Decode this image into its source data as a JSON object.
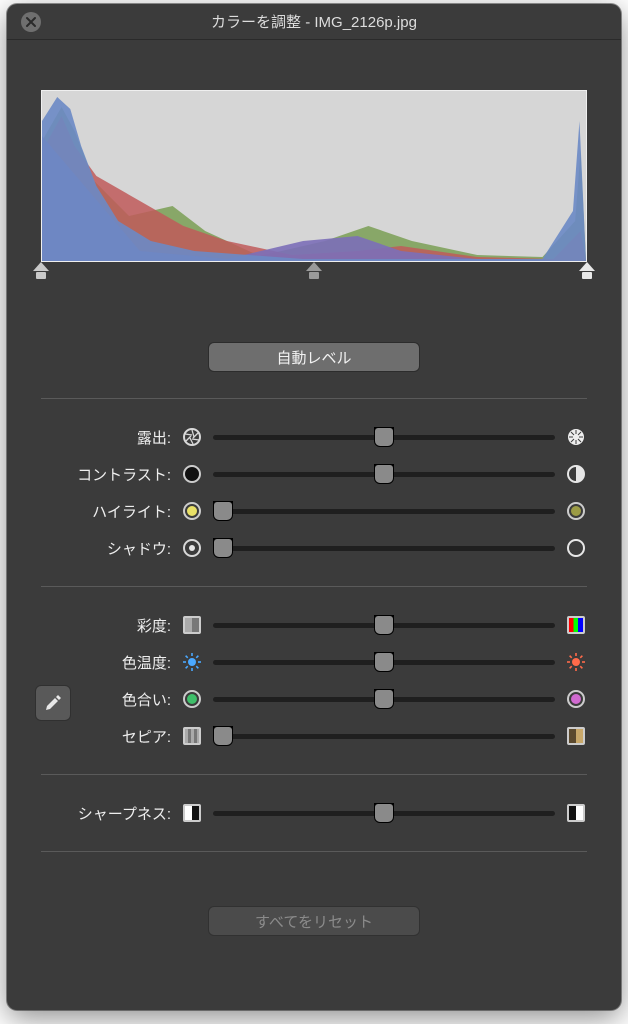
{
  "window": {
    "title": "カラーを調整 - IMG_2126p.jpg"
  },
  "buttons": {
    "auto_levels": "自動レベル",
    "reset_all": "すべてをリセット"
  },
  "histogram": {
    "handles": [
      0,
      50,
      100
    ]
  },
  "groups": [
    {
      "rows": [
        {
          "key": "exposure",
          "label": "露出:",
          "value": 50,
          "left_icon": "aperture",
          "right_icon": "aperture-open"
        },
        {
          "key": "contrast",
          "label": "コントラスト:",
          "value": 50,
          "left_icon": "circle-dark",
          "right_icon": "circle-half"
        },
        {
          "key": "highlights",
          "label": "ハイライト:",
          "value": 3,
          "left_icon": "dot-yellow",
          "right_icon": "dot-olive"
        },
        {
          "key": "shadows",
          "label": "シャドウ:",
          "value": 3,
          "left_icon": "target",
          "right_icon": "ring"
        }
      ]
    },
    {
      "eyedropper": true,
      "rows": [
        {
          "key": "saturation",
          "label": "彩度:",
          "value": 50,
          "left_icon": "sq-gray",
          "right_icon": "sq-rgb"
        },
        {
          "key": "temperature",
          "label": "色温度:",
          "value": 50,
          "left_icon": "sun-blue",
          "right_icon": "sun-red"
        },
        {
          "key": "tint",
          "label": "色合い:",
          "value": 50,
          "left_icon": "dot-green",
          "right_icon": "dot-magenta"
        },
        {
          "key": "sepia",
          "label": "セピア:",
          "value": 3,
          "left_icon": "sq-stripe",
          "right_icon": "sq-sepia"
        }
      ]
    },
    {
      "rows": [
        {
          "key": "sharpness",
          "label": "シャープネス:",
          "value": 50,
          "left_icon": "sq-half-bw",
          "right_icon": "sq-half-wb"
        }
      ]
    }
  ]
}
